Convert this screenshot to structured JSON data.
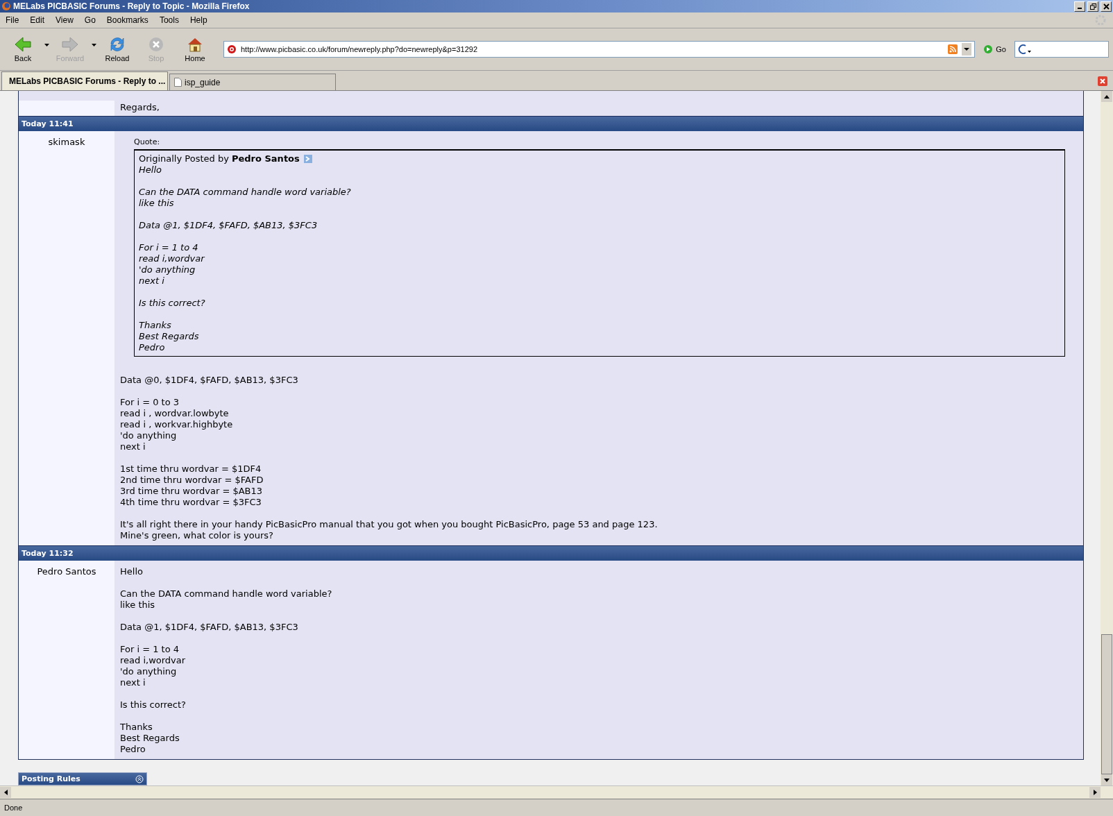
{
  "window": {
    "title": "MELabs PICBASIC Forums - Reply to Topic - Mozilla Firefox"
  },
  "menu": [
    "File",
    "Edit",
    "View",
    "Go",
    "Bookmarks",
    "Tools",
    "Help"
  ],
  "toolbar": [
    {
      "kind": "back",
      "label": "Back",
      "disabled": false,
      "dropdown": true
    },
    {
      "kind": "forward",
      "label": "Forward",
      "disabled": true,
      "dropdown": true
    },
    {
      "kind": "reload",
      "label": "Reload",
      "disabled": false,
      "dropdown": false
    },
    {
      "kind": "stop",
      "label": "Stop",
      "disabled": true,
      "dropdown": false
    },
    {
      "kind": "home",
      "label": "Home",
      "disabled": false,
      "dropdown": false
    }
  ],
  "address": {
    "value": "http://www.picbasic.co.uk/forum/newreply.php?do=newreply&p=31292"
  },
  "go_button": "Go",
  "tabs": [
    {
      "label": "MELabs PICBASIC Forums - Reply to ...",
      "selected": true
    },
    {
      "label": "isp_guide",
      "selected": false
    }
  ],
  "posts": [
    {
      "paragraphs": [
        [
          "Regards,"
        ]
      ]
    },
    {
      "date": "Today 11:41",
      "author": "skimask",
      "quote": {
        "caption": "Quote:",
        "byline": "Originally Posted by **Pedro Santos**",
        "paragraphs": [
          [
            "Hello"
          ],
          [
            "Can the DATA command handle word variable?",
            "like this"
          ],
          [
            "Data @1, $1DF4, $FAFD, $AB13, $3FC3"
          ],
          [
            "For i = 1 to 4",
            "read i,wordvar",
            "'do anything",
            "next i"
          ],
          [
            "Is this correct?"
          ],
          [
            "Thanks",
            "Best Regards",
            "Pedro"
          ]
        ]
      },
      "paragraphs": [
        [
          "Data @0, $1DF4, $FAFD, $AB13, $3FC3"
        ],
        [
          "For i = 0 to 3",
          "read i , wordvar.lowbyte",
          "read i , workvar.highbyte",
          "'do anything",
          "next i"
        ],
        [
          "1st time thru wordvar = $1DF4",
          "2nd time thru wordvar = $FAFD",
          "3rd time thru wordvar = $AB13",
          "4th time thru wordvar = $3FC3"
        ],
        [
          "It's all right there in your handy PicBasicPro manual that you got when you bought PicBasicPro, page 53 and page 123.",
          "Mine's green, what color is yours?"
        ]
      ]
    },
    {
      "date": "Today 11:32",
      "author": "Pedro Santos",
      "paragraphs": [
        [
          "Hello"
        ],
        [
          "Can the DATA command handle word variable?",
          "like this"
        ],
        [
          "Data @1, $1DF4, $FAFD, $AB13, $3FC3"
        ],
        [
          "For i = 1 to 4",
          "read i,wordvar",
          "'do anything",
          "next i"
        ],
        [
          "Is this correct?"
        ],
        [
          "Thanks",
          "Best Regards",
          "Pedro"
        ]
      ]
    }
  ],
  "posting_rules": {
    "title": "Posting Rules"
  },
  "status_bar": "Done"
}
